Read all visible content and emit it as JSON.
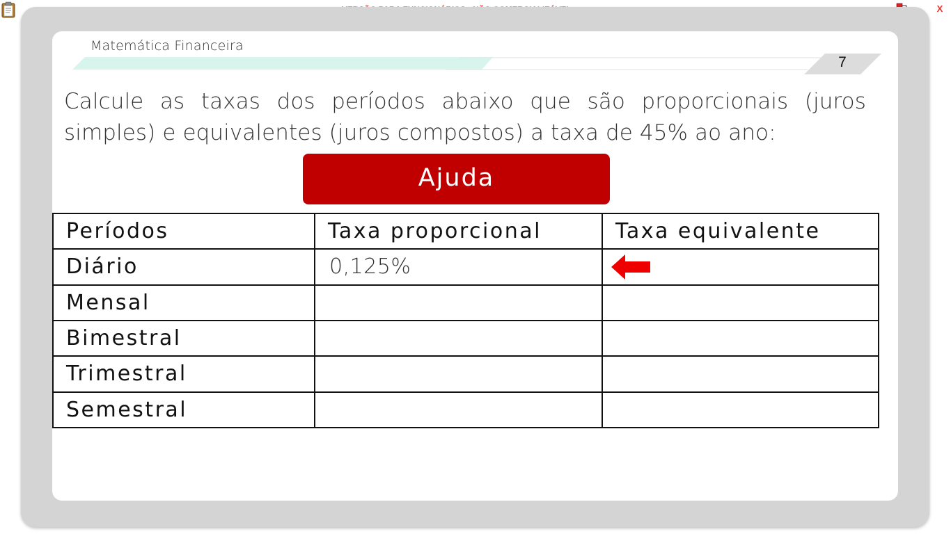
{
  "header": {
    "watermark": "VERSÃO PARA FUNCIONÁRIOS - NÃO COMERCIALIZÁVEL",
    "close_label": "X",
    "left_icon": "clipboard-icon",
    "right_icon": "network-status-icon"
  },
  "lesson": {
    "course_title": "Matemática Financeira",
    "page_number": "7",
    "question": "Calcule as taxas dos períodos abaixo que são proporcionais (juros simples) e equivalentes (juros compostos) a taxa de 45% ao ano:",
    "help_label": "Ajuda"
  },
  "table": {
    "headers": [
      "Períodos",
      "Taxa proporcional",
      "Taxa equivalente"
    ],
    "rows": [
      {
        "period": "Diário",
        "proportional": "0,125%",
        "equivalent": ""
      },
      {
        "period": "Mensal",
        "proportional": "",
        "equivalent": ""
      },
      {
        "period": "Bimestral",
        "proportional": "",
        "equivalent": ""
      },
      {
        "period": "Trimestral",
        "proportional": "",
        "equivalent": ""
      },
      {
        "period": "Semestral",
        "proportional": "",
        "equivalent": ""
      }
    ],
    "pointer_icon": "left-arrow-icon"
  },
  "colors": {
    "accent_red": "#c00000",
    "watermark_red": "#e8332a",
    "frame_gray": "#d4d4d4",
    "header_mint": "#d7f5ec"
  }
}
